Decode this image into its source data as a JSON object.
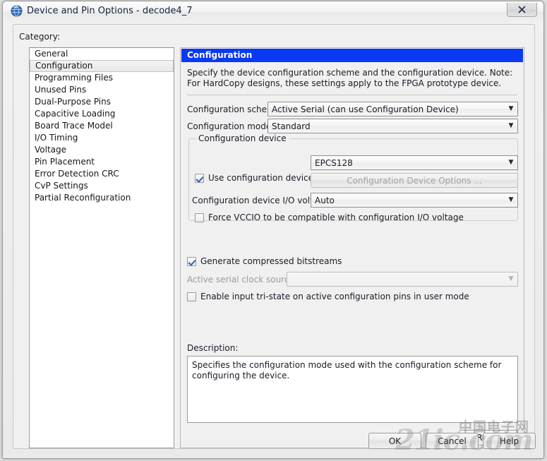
{
  "window": {
    "title": "Device and Pin Options - decode4_7",
    "icon": "quartus-globe-icon",
    "close_label": "✕"
  },
  "category": {
    "label": "Category:",
    "items": [
      {
        "label": "General",
        "selected": false
      },
      {
        "label": "Configuration",
        "selected": true
      },
      {
        "label": "Programming Files",
        "selected": false
      },
      {
        "label": "Unused Pins",
        "selected": false
      },
      {
        "label": "Dual-Purpose Pins",
        "selected": false
      },
      {
        "label": "Capacitive Loading",
        "selected": false
      },
      {
        "label": "Board Trace Model",
        "selected": false
      },
      {
        "label": "I/O Timing",
        "selected": false
      },
      {
        "label": "Voltage",
        "selected": false
      },
      {
        "label": "Pin Placement",
        "selected": false
      },
      {
        "label": "Error Detection CRC",
        "selected": false
      },
      {
        "label": "CvP Settings",
        "selected": false
      },
      {
        "label": "Partial Reconfiguration",
        "selected": false
      }
    ]
  },
  "panel": {
    "header": "Configuration",
    "description": "Specify the device configuration scheme and the configuration device. Note: For HardCopy designs, these settings apply to the FPGA prototype device.",
    "scheme_label": "Configuration scheme:",
    "scheme_value": "Active Serial (can use Configuration Device)",
    "mode_label": "Configuration mode:",
    "mode_value": "Standard",
    "device_group": {
      "title": "Configuration device",
      "use_device_label": "Use configuration device:",
      "use_device_checked": true,
      "device_value": "EPCS128",
      "device_options_button": "Configuration Device Options ...",
      "io_voltage_label": "Configuration device I/O voltage:",
      "io_voltage_value": "Auto",
      "force_vccio_label": "Force VCCIO to be compatible with configuration I/O voltage",
      "force_vccio_checked": false
    },
    "compressed_label": "Generate compressed bitstreams",
    "compressed_checked": true,
    "clock_source_label": "Active serial clock source:",
    "clock_source_value": "",
    "tristate_label": "Enable input tri-state on active configuration pins in user mode",
    "tristate_checked": false,
    "description_label": "Description:",
    "description_text": "Specifies the configuration mode used with the configuration scheme for configuring the device.",
    "reset_button": "Reset"
  },
  "footer": {
    "ok": "OK",
    "cancel": "Cancel",
    "help": "Help"
  },
  "watermark": {
    "text": "21ic.com",
    "text_cn": "中国电子网"
  },
  "colors": {
    "header_blue": "#0a39f5",
    "window_bg": "#f0f0f0",
    "check_blue": "#3060b8"
  }
}
